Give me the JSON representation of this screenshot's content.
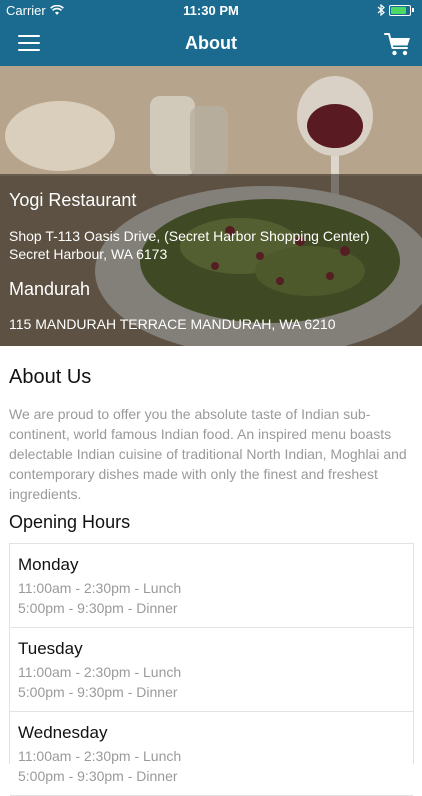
{
  "status_bar": {
    "carrier": "Carrier",
    "time": "11:30 PM"
  },
  "nav": {
    "title": "About",
    "menu_icon": "hamburger-menu-icon",
    "cart_icon": "shopping-cart-icon",
    "background_color": "#1a6b8f"
  },
  "hero": {
    "restaurant_name": "Yogi Restaurant",
    "address_line_1": "Shop T-113 Oasis Drive, (Secret Harbor Shopping Center)",
    "address_line_2": "Secret Harbour, WA 6173",
    "second_location_name": "Mandurah",
    "second_location_address": "115 MANDURAH TERRACE MANDURAH, WA 6210"
  },
  "about": {
    "heading": "About Us",
    "text": "We are proud to offer you the absolute taste of Indian sub-continent, world famous Indian food. An inspired menu boasts delectable Indian cuisine of traditional North Indian, Moghlai and contemporary dishes made with only the finest and freshest ingredients."
  },
  "hours": {
    "heading": "Opening Hours",
    "days": [
      {
        "day": "Monday",
        "lunch": "11:00am - 2:30pm - Lunch",
        "dinner": "5:00pm - 9:30pm - Dinner"
      },
      {
        "day": "Tuesday",
        "lunch": "11:00am - 2:30pm - Lunch",
        "dinner": "5:00pm - 9:30pm - Dinner"
      },
      {
        "day": "Wednesday",
        "lunch": "11:00am - 2:30pm - Lunch",
        "dinner": "5:00pm - 9:30pm - Dinner"
      }
    ]
  }
}
